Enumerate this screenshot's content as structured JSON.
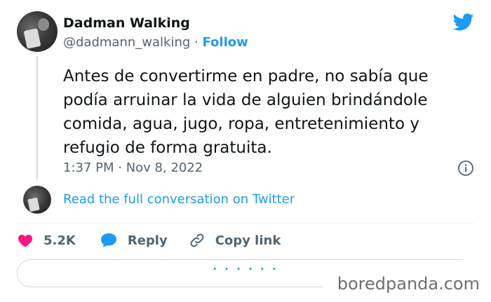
{
  "user": {
    "name": "Dadman Walking",
    "handle": "@dadmann_walking",
    "separator": "·",
    "follow_label": "Follow"
  },
  "tweet": {
    "text": "Antes de convertirme en padre, no sabía que podía arruinar la vida de alguien brindándole comida, agua, jugo, ropa, entretenimiento y refugio de forma gratuita.",
    "timestamp": "1:37 PM · Nov 8, 2022"
  },
  "conversation_link": "Read the full conversation on Twitter",
  "actions": {
    "likes": "5.2K",
    "reply_label": "Reply",
    "copy_label": "Copy link"
  },
  "replies_partial": "· · · · · ·",
  "watermark": "boredpanda.com",
  "colors": {
    "accent": "#1d9bf0",
    "like": "#f91880",
    "text": "#0f1419",
    "secondary": "#536471"
  }
}
